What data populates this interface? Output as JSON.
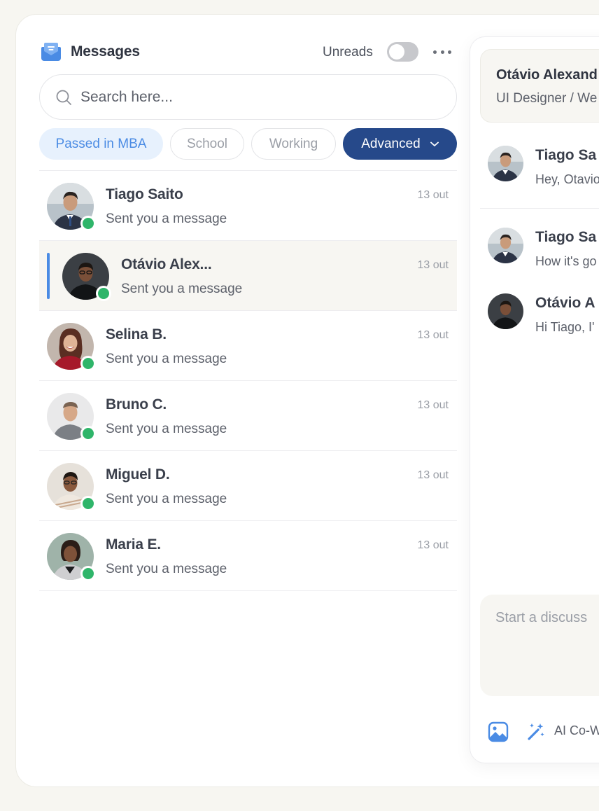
{
  "header": {
    "title": "Messages",
    "unreads_label": "Unreads",
    "unreads_enabled": false
  },
  "search": {
    "placeholder": "Search here..."
  },
  "filters": [
    {
      "label": "Passed in MBA",
      "state": "selected"
    },
    {
      "label": "School",
      "state": "default"
    },
    {
      "label": "Working",
      "state": "default"
    },
    {
      "label": "Advanced",
      "state": "dropdown"
    }
  ],
  "conversations": [
    {
      "name": "Tiago Saito",
      "preview": "Sent you a message",
      "time": "13 out",
      "online": true,
      "active": false
    },
    {
      "name": "Otávio Alex...",
      "preview": "Sent you a message",
      "time": "13 out",
      "online": true,
      "active": true
    },
    {
      "name": "Selina B.",
      "preview": "Sent you a message",
      "time": "13 out",
      "online": true,
      "active": false
    },
    {
      "name": "Bruno C.",
      "preview": "Sent you a message",
      "time": "13 out",
      "online": true,
      "active": false
    },
    {
      "name": "Miguel D.",
      "preview": "Sent you a message",
      "time": "13 out",
      "online": true,
      "active": false
    },
    {
      "name": "Maria E.",
      "preview": "Sent you a message",
      "time": "13 out",
      "online": true,
      "active": false
    }
  ],
  "chat": {
    "contact_name": "Otávio Alexand",
    "contact_role": "UI Designer / We",
    "messages": [
      {
        "sender": "Tiago Sa",
        "text": "Hey, Otavio"
      },
      {
        "sender": "Tiago Sa",
        "text": "How it's go"
      },
      {
        "sender": "Otávio A",
        "text": "Hi Tiago, I'"
      }
    ],
    "composer_placeholder": "Start a discuss",
    "ai_label": "AI Co-W"
  },
  "colors": {
    "accent_blue": "#4a8be4",
    "advanced_chip": "#26498a",
    "online": "#2fb56a",
    "active_row": "#f7f6f2"
  }
}
